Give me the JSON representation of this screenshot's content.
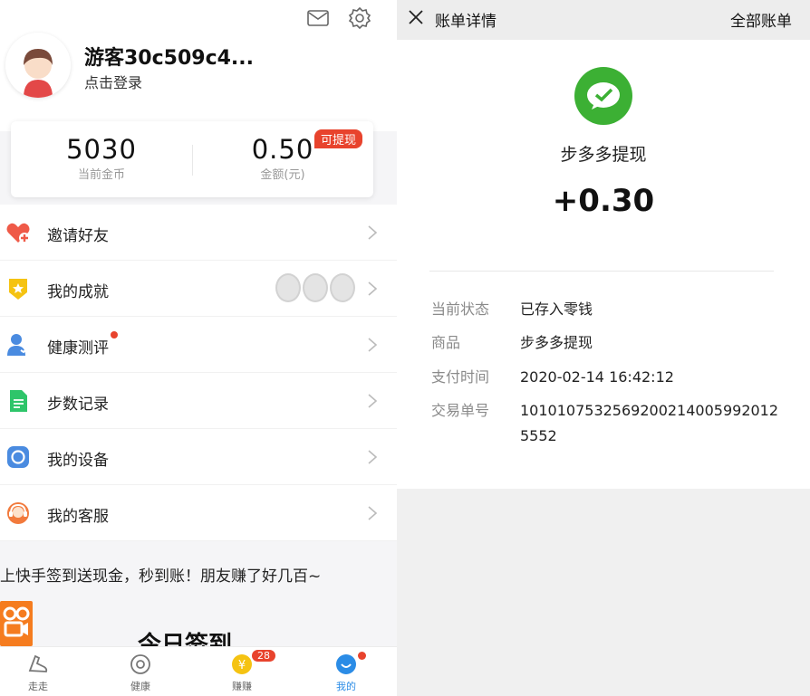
{
  "profile": {
    "username": "游客30c509c4...",
    "login_prompt": "点击登录"
  },
  "stats": {
    "coins_value": "5030",
    "coins_label": "当前金币",
    "amount_value": "0.50",
    "amount_label": "金额(元)",
    "withdraw_badge": "可提现"
  },
  "menu": {
    "items": [
      {
        "label": "邀请好友",
        "icon": "heart-plus-icon"
      },
      {
        "label": "我的成就",
        "icon": "star-badge-icon"
      },
      {
        "label": "健康测评",
        "icon": "person-icon"
      },
      {
        "label": "步数记录",
        "icon": "document-icon"
      },
      {
        "label": "我的设备",
        "icon": "device-icon"
      },
      {
        "label": "我的客服",
        "icon": "headset-icon"
      }
    ]
  },
  "promo": {
    "text": "上快手签到送现金，秒到账！朋友赚了好几百~",
    "signin_title": "今日签到"
  },
  "tabbar": {
    "tabs": [
      {
        "label": "走走",
        "icon": "shoe-icon"
      },
      {
        "label": "健康",
        "icon": "health-icon"
      },
      {
        "label": "赚赚",
        "icon": "coin-icon"
      },
      {
        "label": "我的",
        "icon": "me-icon"
      }
    ],
    "earn_badge": "28",
    "active": "我的"
  },
  "bill": {
    "header_title": "账单详情",
    "all_bills": "全部账单",
    "merchant": "步多多提现",
    "amount": "+0.30",
    "fields": [
      {
        "key": "当前状态",
        "value": "已存入零钱"
      },
      {
        "key": "商品",
        "value": "步多多提现"
      },
      {
        "key": "支付时间",
        "value": "2020-02-14 16:42:12"
      },
      {
        "key": "交易单号",
        "value": "10101075325692002140059920125552"
      }
    ]
  },
  "colors": {
    "accent_red": "#e8432d",
    "wechat_green": "#3cb034",
    "active_blue": "#2b8ce6"
  }
}
